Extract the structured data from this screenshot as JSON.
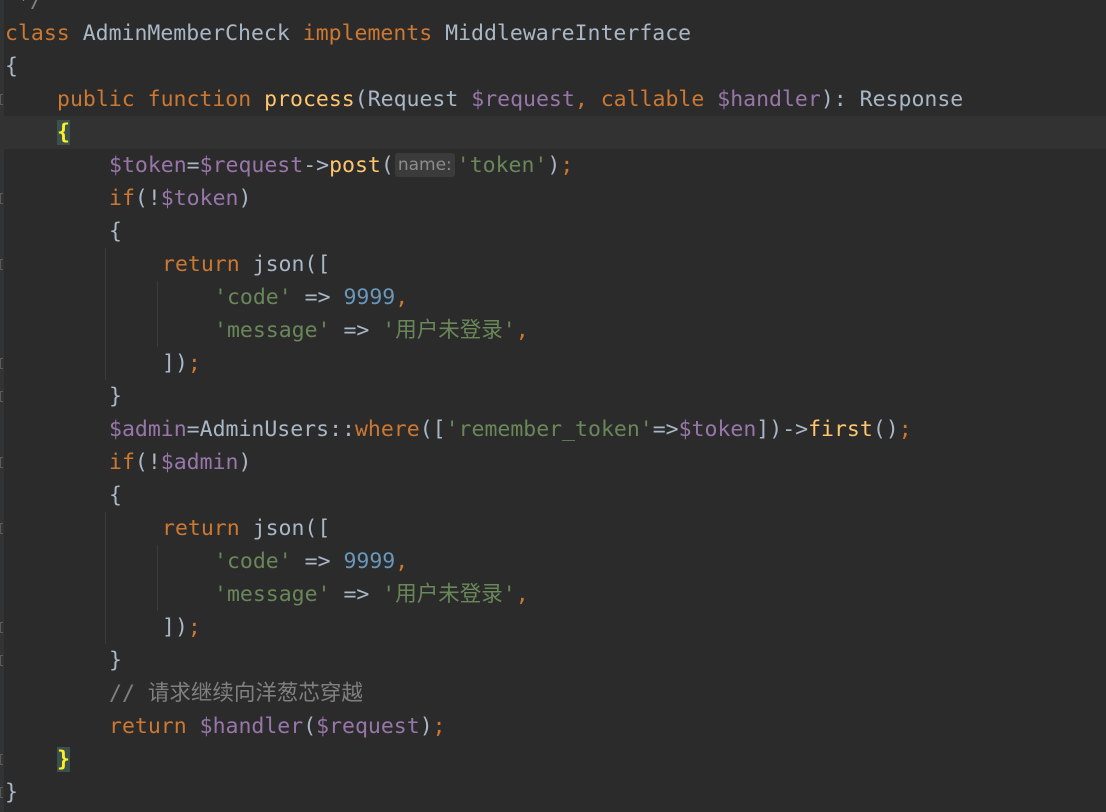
{
  "colors": {
    "background": "#2b2b2b",
    "keyword": "#cc7832",
    "variable": "#9876aa",
    "string": "#6a8759",
    "number": "#6897bb",
    "function": "#ffc66d",
    "comment": "#808080",
    "plain": "#a9b7c6",
    "brace_match": "#ffef28"
  },
  "code": {
    "top_fragment": "*/",
    "kw_class": "class",
    "class_name": "AdminMemberCheck",
    "kw_implements": "implements",
    "interface_name": "MiddlewareInterface",
    "open_brace": "{",
    "close_brace": "}",
    "kw_public": "public",
    "kw_function": "function",
    "method_name": "process",
    "lparen": "(",
    "rparen": ")",
    "type_request": "Request",
    "var_request": "$request",
    "comma": ",",
    "kw_callable": "callable",
    "var_handler": "$handler",
    "colon": ":",
    "return_type": "Response",
    "var_token": "$token",
    "eq": "=",
    "arrow": "->",
    "fn_post": "post",
    "hint_name": "name:",
    "str_token": "'token'",
    "semicolon": ";",
    "kw_if": "if",
    "not": "!",
    "kw_return": "return",
    "fn_json": "json",
    "lbracket": "[",
    "rbracket": "]",
    "str_code": "'code'",
    "fat_arrow": "=>",
    "num_9999": "9999",
    "str_message": "'message'",
    "str_msg_value": "'用户未登录'",
    "var_admin": "$admin",
    "class_adminusers": "AdminUsers",
    "scope": "::",
    "fn_where": "where",
    "str_remember_token": "'remember_token'",
    "fn_first": "first",
    "comment": "// 请求继续向洋葱芯穿越"
  }
}
